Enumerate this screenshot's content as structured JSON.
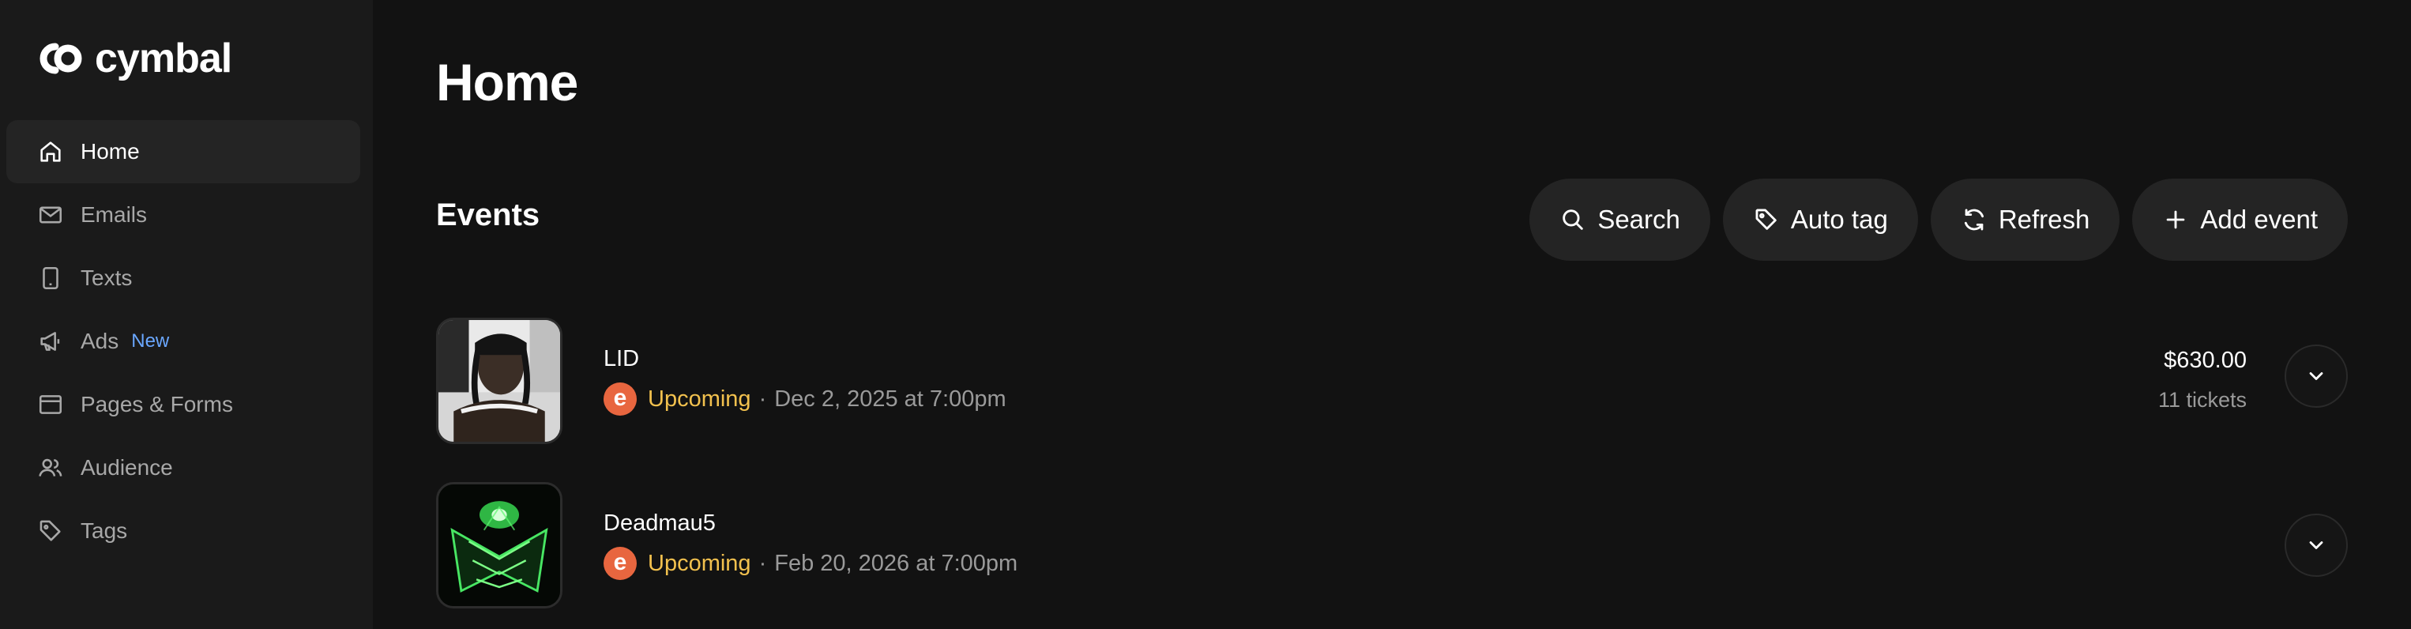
{
  "brand": {
    "name": "cymbal"
  },
  "sidebar": {
    "items": [
      {
        "label": "Home",
        "icon": "home-icon",
        "active": true
      },
      {
        "label": "Emails",
        "icon": "mail-icon"
      },
      {
        "label": "Texts",
        "icon": "phone-icon"
      },
      {
        "label": "Ads",
        "icon": "megaphone-icon",
        "badge": "New"
      },
      {
        "label": "Pages & Forms",
        "icon": "browser-window-icon"
      },
      {
        "label": "Audience",
        "icon": "users-icon"
      },
      {
        "label": "Tags",
        "icon": "tag-icon"
      }
    ]
  },
  "main": {
    "title": "Home",
    "section_title": "Events",
    "toolbar": {
      "search": "Search",
      "auto_tag": "Auto tag",
      "refresh": "Refresh",
      "add_event": "Add event"
    },
    "events": [
      {
        "name": "LID",
        "status": "Upcoming",
        "separator": "·",
        "date": "Dec 2, 2025 at 7:00pm",
        "price": "$630.00",
        "tickets": "11 tickets",
        "source_badge": "e"
      },
      {
        "name": "Deadmau5",
        "status": "Upcoming",
        "separator": "·",
        "date": "Feb 20, 2026 at 7:00pm",
        "source_badge": "e"
      }
    ]
  },
  "colors": {
    "background": "#121212",
    "sidebar": "#1a1a1a",
    "active_item": "#242424",
    "status_upcoming": "#f2c14e",
    "new_badge": "#6aa7ff",
    "eventbrite_orange": "#e8663f"
  }
}
